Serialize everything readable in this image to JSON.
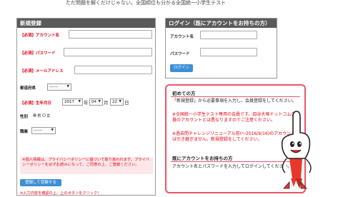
{
  "tagline": "ただ問題を解くだけじゃない。全国順位も分かる全国統一小学生テスト",
  "register": {
    "title": "新規登録",
    "required_tag": "【必須】",
    "account_label": "アカウント名",
    "password_label": "パスワード",
    "email_label": "メールアドレス",
    "pref_label": "都道府県",
    "pref_value": "------",
    "birth_label": "生年月日",
    "birth_year": "2017",
    "birth_year_unit": "年",
    "birth_month": "04",
    "birth_month_unit": "月",
    "birth_day": "22",
    "birth_day_unit": "日",
    "gender_label": "性別",
    "gender_male": "男",
    "gender_female": "女",
    "job_label": "職業",
    "job_value": "------",
    "policy_text_1": "※個人情報は、プライバシーポリシーに基づいて取り扱われます。プライバシーポリシーを必ずお読みになって、ご同意の上、ご登録ください。",
    "policy_link": "プライバシーポリシー",
    "submit_label": "登録して受験する",
    "note": "※入力内容を確認の上、上のボタンをクリック！"
  },
  "login": {
    "title": "ログイン（既にアカウントをお持ちの方）",
    "account_label": "アカウント名",
    "password_label": "パスワード",
    "button_label": "ログイン"
  },
  "info": {
    "first_title": "初めての方",
    "first_text": "「新規登録」から必要事項を入力し、会員登録をしてください。",
    "red_text_1": "※全国統一小学生テスト専用の会員です。四谷大塚ドットコム会員のアカウントとは異なりますのでご注意ください。",
    "red_text_2": "※過去問チャレンジリニューアル前(～2016/9/16)のアカウントは引き継ぎません。新規登録をしてください。",
    "existing_title": "既にアカウントをお持ちの方",
    "existing_text": "アカウント名とパスワードを入力してログインしてください。"
  },
  "colors": {
    "panel_header": "#5a5a5a",
    "required_red": "#e60012",
    "button_blue": "#3d8fd6",
    "info_border": "#e8546a"
  }
}
